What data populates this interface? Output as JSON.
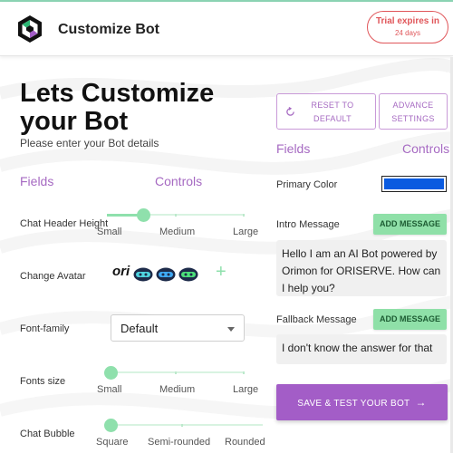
{
  "header": {
    "title": "Customize Bot",
    "logo_icon": "bot-logo-icon",
    "trial_line1": "Trial expires in",
    "trial_line2": "24 days"
  },
  "intro": {
    "title_line1": "Lets Customize",
    "title_line2": "your Bot",
    "subtitle": "Please enter your Bot details"
  },
  "left_columns": {
    "fields": "Fields",
    "controls": "Controls"
  },
  "rows": {
    "chat_header_height": {
      "label": "Chat Header Height",
      "options": [
        "Small",
        "Medium",
        "Large"
      ],
      "selected_index": 0.25
    },
    "change_avatar": {
      "label": "Change Avatar",
      "oni": "ori",
      "add": "+"
    },
    "font_family": {
      "label": "Font-family",
      "value": "Default"
    },
    "fonts_size": {
      "label": "Fonts size",
      "options": [
        "Small",
        "Medium",
        "Large"
      ],
      "selected_index": 0
    },
    "chat_bubble": {
      "label": "Chat Bubble",
      "options": [
        "Square",
        "Semi-rounded",
        "Rounded"
      ],
      "selected_index": 0
    }
  },
  "right": {
    "reset_line1": "RESET TO",
    "reset_line2": "DEFAULT",
    "advance_line1": "ADVANCE",
    "advance_line2": "SETTINGS",
    "fields": "Fields",
    "controls": "Controls",
    "primary_color_label": "Primary Color",
    "primary_color": "#0a5be0",
    "intro_label": "Intro Message",
    "intro_add": "ADD MESSAGE",
    "intro_text": "Hello I am an AI Bot powered by Orimon for ORISERVE. How can I help you?",
    "fallback_label": "Fallback Message",
    "fallback_add": "ADD MESSAGE",
    "fallback_text": "I don't know the answer for that",
    "save_label": "SAVE & TEST YOUR BOT",
    "save_arrow": "→"
  },
  "colors": {
    "accent_purple": "#a35dc7",
    "accent_green": "#8fe0a8",
    "trial_red": "#e0565a"
  }
}
